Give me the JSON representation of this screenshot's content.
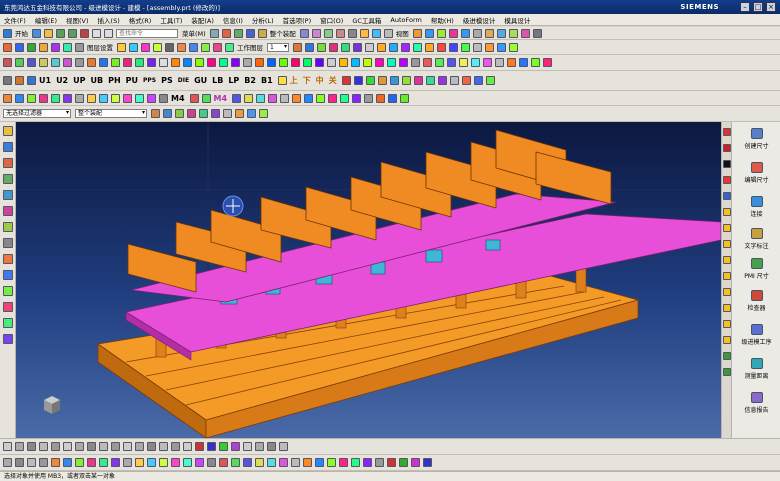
{
  "window": {
    "title": "东莞鸿达五金科技有限公司 - 级进模设计 - 建模 - [assembly.prt (修改的)]",
    "brand": "SIEMENS"
  },
  "menu": [
    "文件(F)",
    "编辑(E)",
    "视图(V)",
    "插入(S)",
    "格式(R)",
    "工具(T)",
    "装配(A)",
    "信息(I)",
    "分析(L)",
    "首选项(P)",
    "窗口(O)",
    "GC工具箱",
    "AutoForm",
    "帮助(H)",
    "级进模设计",
    "模具设计"
  ],
  "toolbar1": {
    "start_label": "开始",
    "search_placeholder": "查找命令",
    "menu_label": "菜单(M)",
    "snap_label": "整个装配",
    "view_label": "视图"
  },
  "toolbar2": {
    "label1": "图层设置",
    "label2": "工作图层",
    "field_value": "1"
  },
  "toolbar3": [
    "U1",
    "U2",
    "UP",
    "UB",
    "PH",
    "PU",
    "PPS",
    "PS",
    "DIE",
    "GU",
    "LB",
    "LP",
    "B2",
    "B1"
  ],
  "toolbar3b": [
    "上",
    "下",
    "中",
    "关"
  ],
  "toolbar4": [
    "M4",
    "M4"
  ],
  "selection": {
    "filter": "无选择过滤器",
    "scope": "整个装配"
  },
  "right_panel": [
    {
      "icon": "size-icon",
      "label": "创建尺寸"
    },
    {
      "icon": "edit-icon",
      "label": "编辑尺寸"
    },
    {
      "icon": "link-icon",
      "label": "连接"
    },
    {
      "icon": "text-icon",
      "label": "文字标注"
    },
    {
      "icon": "pmi-icon",
      "label": "PMI 尺寸"
    },
    {
      "icon": "check-icon",
      "label": "检查器"
    },
    {
      "icon": "process-icon",
      "label": "级进模工序"
    },
    {
      "icon": "measure-icon",
      "label": "测量距离"
    },
    {
      "icon": "report-icon",
      "label": "信息报告"
    }
  ],
  "status": "选择对象并使用 MB3，或者双击某一对象",
  "colors": {
    "die_plate": "#f28c1e",
    "pink_plate": "#e84fd8",
    "cyan_part": "#3fb5d8",
    "viewport_top": "#0c1840",
    "viewport_bottom": "#4a6aa8"
  }
}
